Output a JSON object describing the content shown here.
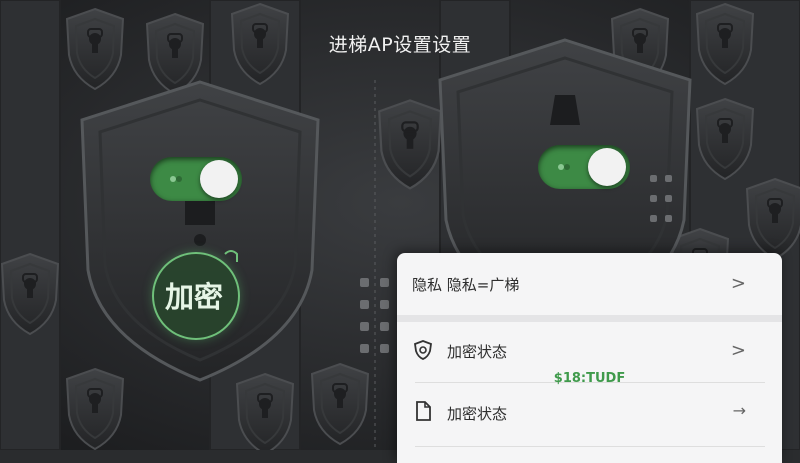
{
  "header": {
    "title": "进梯AP设置设置"
  },
  "toggles": [
    {
      "name": "left",
      "state": "on"
    },
    {
      "name": "right",
      "state": "on"
    }
  ],
  "badge": {
    "label": "加密"
  },
  "panel": {
    "rows": [
      {
        "label": "隐私  隐私=广梯",
        "trailing": ">"
      },
      {
        "label": "加密状态",
        "trailing": ">",
        "icon": "shield-icon"
      },
      {
        "label": "加密状态",
        "trailing": "→",
        "icon": "document-icon"
      }
    ],
    "overlay_text": "$18:TUDF"
  },
  "colors": {
    "accent": "#3d8a45",
    "background": "#2a2c2e",
    "panel": "#f5f5f6",
    "overlay": "#3f9a4b"
  }
}
